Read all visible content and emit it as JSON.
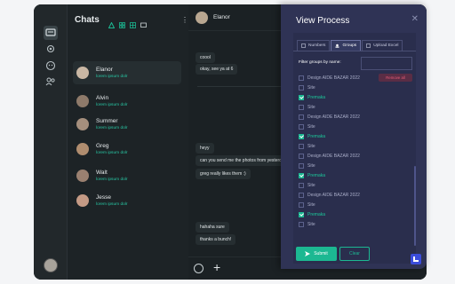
{
  "sidebar": {
    "icons": [
      "chat-icon",
      "group-icon",
      "support-icon",
      "contacts-icon"
    ]
  },
  "chatlist": {
    "title": "Chats",
    "more": "⋮",
    "contacts": [
      {
        "name": "Elanor",
        "subtitle": "lorem ipsum dolr",
        "avatar_color": "#c9b7a4"
      },
      {
        "name": "Alvin",
        "subtitle": "lorem ipsum dolr",
        "avatar_color": "#8e7a6a"
      },
      {
        "name": "Summer",
        "subtitle": "lorem ipsum dolr",
        "avatar_color": "#a58f7d"
      },
      {
        "name": "Greg",
        "subtitle": "lorem ipsum dolr",
        "avatar_color": "#b08d6f"
      },
      {
        "name": "Walt",
        "subtitle": "lorem ipsum dolr",
        "avatar_color": "#9a8070"
      },
      {
        "name": "Jesse",
        "subtitle": "lorem ipsum dolr",
        "avatar_color": "#c49a85"
      }
    ]
  },
  "chat": {
    "contact_name": "Elanor",
    "messages": [
      "coool",
      "okay, see ya at 6",
      "heyy",
      "can you send me the photos from yesterday?",
      "greg really likes them :)",
      "hahaha sure",
      "thanks a bunch!"
    ]
  },
  "dialog": {
    "title": "View Process",
    "close": "✕",
    "tabs": [
      "Numbers",
      "Groups",
      "Upload Excel"
    ],
    "active_tab": "Groups",
    "filter_label": "Filter groups by name:",
    "filter_value": "",
    "remove_all": "Remove all",
    "rows": [
      {
        "label": "Design AIDE BAZAR 2022",
        "checked": false,
        "color": "normal"
      },
      {
        "label": "Site",
        "checked": false,
        "color": "normal"
      },
      {
        "label": "Premaka",
        "checked": true,
        "color": "green"
      },
      {
        "label": "Site",
        "checked": false,
        "color": "normal"
      },
      {
        "label": "Design AIDE BAZAR 2022",
        "checked": false,
        "color": "normal"
      },
      {
        "label": "Site",
        "checked": false,
        "color": "normal"
      },
      {
        "label": "Premaka",
        "checked": true,
        "color": "green"
      },
      {
        "label": "Site",
        "checked": false,
        "color": "normal"
      },
      {
        "label": "Design AIDE BAZAR 2022",
        "checked": false,
        "color": "normal"
      },
      {
        "label": "Site",
        "checked": false,
        "color": "normal"
      },
      {
        "label": "Premaka",
        "checked": true,
        "color": "green"
      },
      {
        "label": "Site",
        "checked": false,
        "color": "normal"
      },
      {
        "label": "Design AIDE BAZAR 2022",
        "checked": false,
        "color": "normal"
      },
      {
        "label": "Site",
        "checked": false,
        "color": "normal"
      },
      {
        "label": "Premaka",
        "checked": true,
        "color": "green"
      },
      {
        "label": "Site",
        "checked": false,
        "color": "normal"
      }
    ],
    "submit": "Submit",
    "clear": "Clear"
  },
  "colors": {
    "accent": "#1cb892",
    "dialog_bg": "#2f3355",
    "app_bg": "#22282b"
  }
}
